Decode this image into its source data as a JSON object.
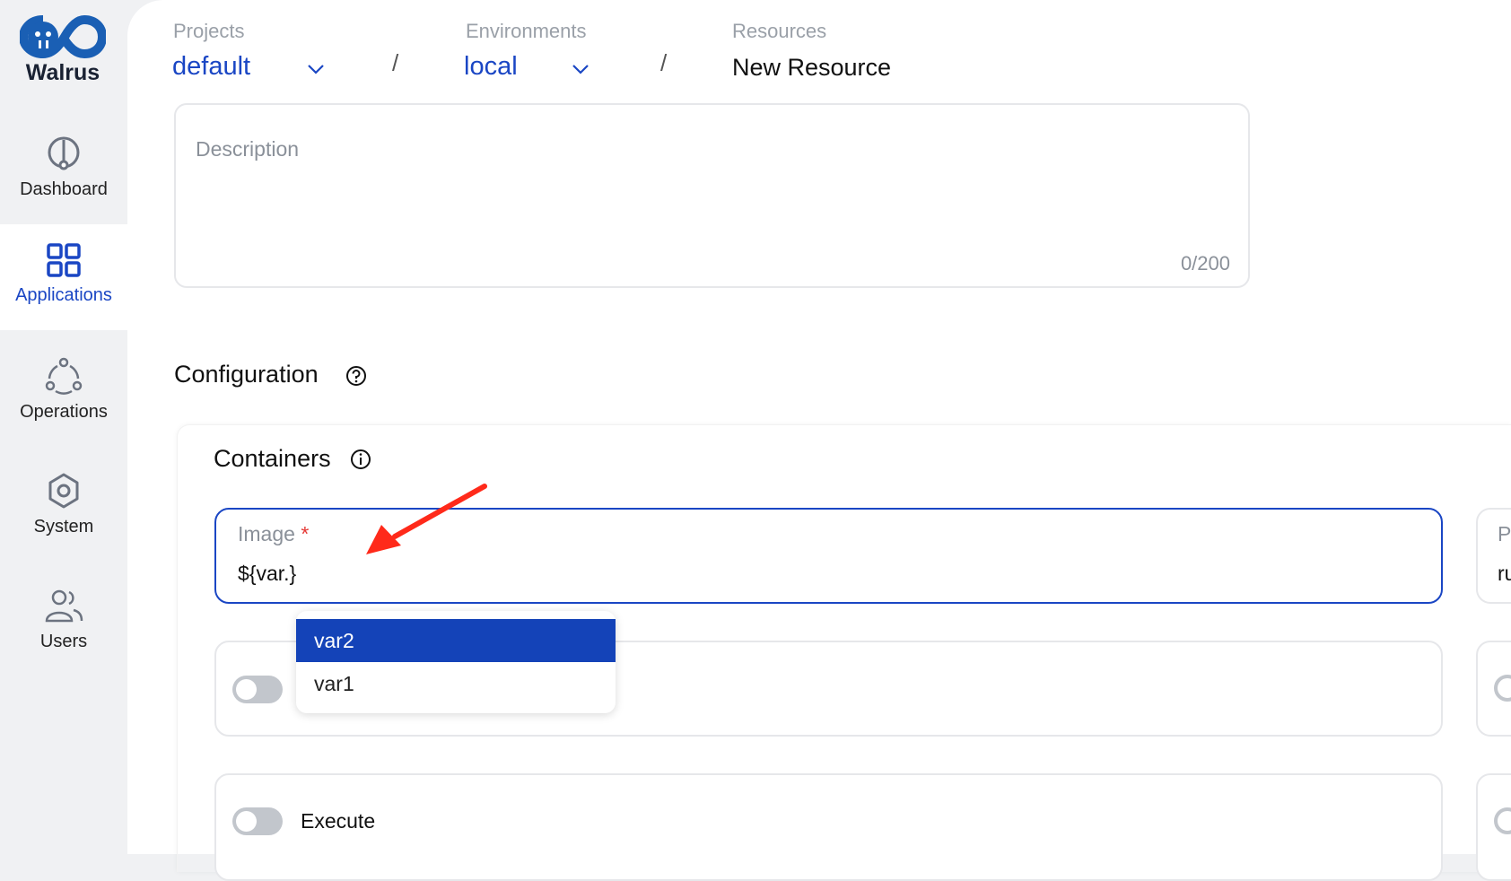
{
  "brand": {
    "name": "Walrus",
    "color": "#1a5fb4"
  },
  "sidebar": {
    "items": [
      {
        "label": "Dashboard",
        "icon": "dashboard-icon",
        "active": false
      },
      {
        "label": "Applications",
        "icon": "applications-icon",
        "active": true
      },
      {
        "label": "Operations",
        "icon": "operations-icon",
        "active": false
      },
      {
        "label": "System",
        "icon": "gear-icon",
        "active": false
      },
      {
        "label": "Users",
        "icon": "users-icon",
        "active": false
      }
    ]
  },
  "breadcrumb": {
    "projects_label": "Projects",
    "projects_value": "default",
    "environments_label": "Environments",
    "environments_value": "local",
    "resources_label": "Resources",
    "resources_value": "New Resource",
    "separator": "/"
  },
  "description": {
    "placeholder": "Description",
    "count": "0/200"
  },
  "configuration": {
    "title": "Configuration"
  },
  "containers": {
    "title": "Containers",
    "image_label": "Image",
    "required_mark": "*",
    "image_value": "${var.}",
    "side_label": "P",
    "side_value": "ru",
    "execute_label": "Execute"
  },
  "autocomplete": {
    "options": [
      "var2",
      "var1"
    ],
    "selected": "var2"
  },
  "colors": {
    "accent": "#1a46c4",
    "selected": "#1443b8",
    "annotation_arrow": "#ff2a1a"
  }
}
